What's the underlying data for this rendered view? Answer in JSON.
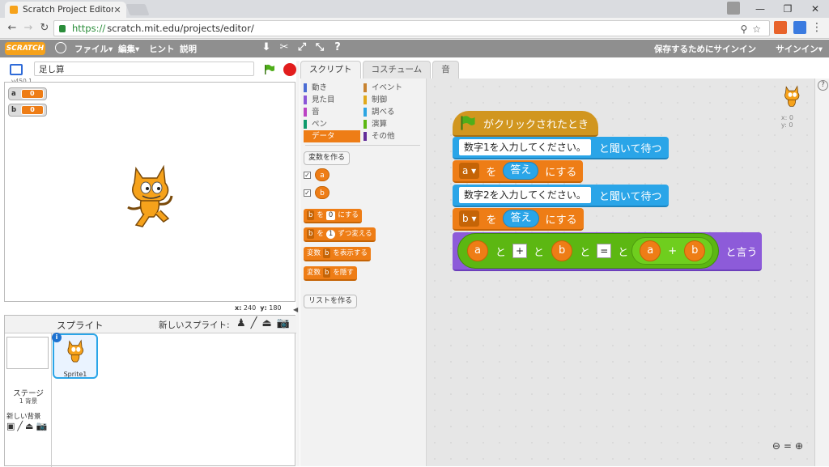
{
  "browser": {
    "tab_title": "Scratch Project Editor - I",
    "url_secure": "https://",
    "url_rest": "scratch.mit.edu/projects/editor/"
  },
  "scratch_bar": {
    "logo": "SCRATCH",
    "menus": [
      "ファイル▾",
      "編集▾",
      "ヒント",
      "説明"
    ],
    "save_signin": "保存するためにサインイン",
    "signin": "サインイン▾"
  },
  "stage": {
    "project_name": "足し算",
    "version": "v450.1",
    "monitors": [
      {
        "label": "a",
        "value": "0"
      },
      {
        "label": "b",
        "value": "0"
      }
    ],
    "coords": {
      "x_label": "x:",
      "x": "240",
      "y_label": "y:",
      "y": "180"
    }
  },
  "sprites_pane": {
    "title": "スプライト",
    "new_sprite": "新しいスプライト:",
    "stage_label": "ステージ",
    "stage_sub": "1 背景",
    "new_backdrop": "新しい背景",
    "sprite_name": "Sprite1"
  },
  "editor_tabs": [
    "スクリプト",
    "コスチューム",
    "音"
  ],
  "categories": [
    {
      "label": "動き",
      "color": "#4a6cd4"
    },
    {
      "label": "イベント",
      "color": "#c88330"
    },
    {
      "label": "見た目",
      "color": "#8a55d7"
    },
    {
      "label": "制御",
      "color": "#e1a91a"
    },
    {
      "label": "音",
      "color": "#bb42c3"
    },
    {
      "label": "調べる",
      "color": "#2ca5e2"
    },
    {
      "label": "ペン",
      "color": "#0e9a6c"
    },
    {
      "label": "演算",
      "color": "#5cb712"
    },
    {
      "label": "データ",
      "color": "#ee7d16"
    },
    {
      "label": "その他",
      "color": "#632d99"
    }
  ],
  "palette": {
    "make_variable": "変数を作る",
    "vars": [
      "a",
      "b"
    ],
    "set_block": {
      "var": "b",
      "text1": "を",
      "value": "0",
      "text2": "にする"
    },
    "change_block": {
      "var": "b",
      "text1": "を",
      "value": "1",
      "text2": "ずつ変える"
    },
    "show_block": {
      "pre": "変数",
      "var": "b",
      "post": "を表示する"
    },
    "hide_block": {
      "pre": "変数",
      "var": "b",
      "post": "を隠す"
    },
    "make_list": "リストを作る"
  },
  "script": {
    "hat": "がクリックされたとき",
    "ask1": {
      "prompt": "数字1を入力してください。",
      "suffix": "と聞いて待つ"
    },
    "set1": {
      "var": "a",
      "wo": "を",
      "answer": "答え",
      "suffix": "にする"
    },
    "ask2": {
      "prompt": "数字2を入力してください。",
      "suffix": "と聞いて待つ"
    },
    "set2": {
      "var": "b",
      "wo": "を",
      "answer": "答え",
      "suffix": "にする"
    },
    "say": {
      "a": "a",
      "to1": "と",
      "plus_sym": "+",
      "to2": "と",
      "b": "b",
      "to3": "と",
      "eq_sym": "=",
      "to4": "と",
      "sum_a": "a",
      "sum_op": "+",
      "sum_b": "b",
      "suffix": "と言う"
    }
  },
  "script_area": {
    "x_label": "x:",
    "x": "0",
    "y_label": "y:",
    "y": "0"
  }
}
